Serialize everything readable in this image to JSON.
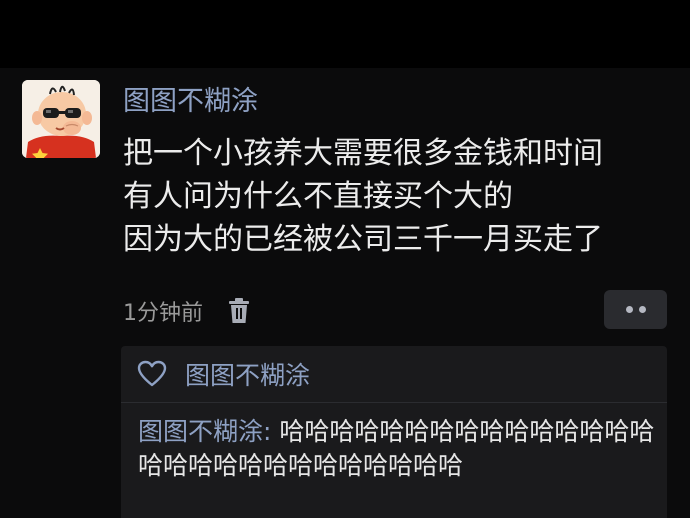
{
  "post": {
    "author": "图图不糊涂",
    "content_lines": [
      "把一个小孩养大需要很多金钱和时间",
      "有人问为什么不直接买个大的",
      "因为大的已经被公司三千一月买走了"
    ],
    "timestamp": "1分钟前"
  },
  "likes": {
    "users": [
      "图图不糊涂"
    ]
  },
  "comments": [
    {
      "author": "图图不糊涂",
      "separator": ": ",
      "text": "哈哈哈哈哈哈哈哈哈哈哈哈哈哈哈哈哈哈哈哈哈哈哈哈哈哈哈哈"
    }
  ],
  "colors": {
    "background": "#0b0b0c",
    "name_blue": "#8ea1c4",
    "panel": "#1a1a1c",
    "more_button": "#2a2b2f"
  },
  "icons": {
    "delete": "trash-icon",
    "more": "more-dots-icon",
    "like": "heart-icon"
  }
}
